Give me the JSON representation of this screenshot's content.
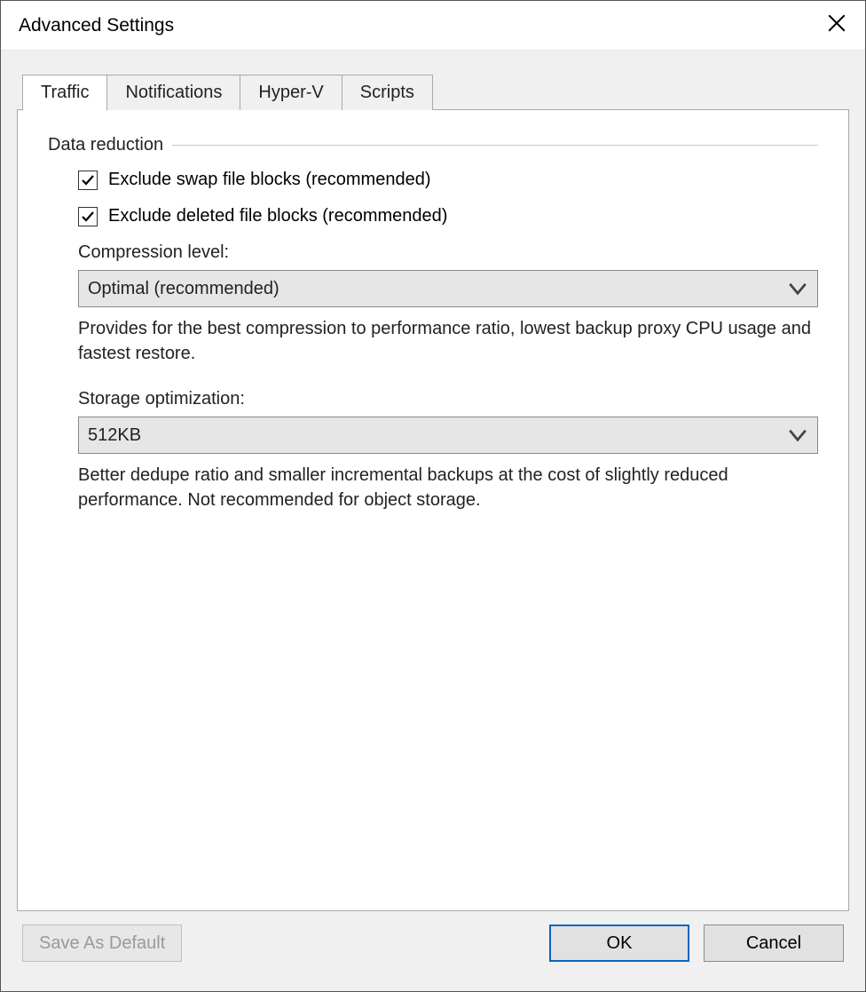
{
  "window": {
    "title": "Advanced Settings"
  },
  "tabs": [
    {
      "label": "Traffic",
      "active": true
    },
    {
      "label": "Notifications",
      "active": false
    },
    {
      "label": "Hyper-V",
      "active": false
    },
    {
      "label": "Scripts",
      "active": false
    }
  ],
  "group": {
    "title": "Data reduction"
  },
  "checks": {
    "swap": {
      "label": "Exclude swap file blocks (recommended)",
      "checked": true
    },
    "deleted": {
      "label": "Exclude deleted file blocks (recommended)",
      "checked": true
    }
  },
  "compression": {
    "label": "Compression level:",
    "value": "Optimal (recommended)",
    "desc": "Provides for the best compression to performance ratio, lowest backup proxy CPU usage and fastest restore."
  },
  "storage": {
    "label": "Storage optimization:",
    "value": "512KB",
    "desc": "Better dedupe ratio and smaller incremental backups at the cost of slightly reduced performance. Not recommended for object storage."
  },
  "buttons": {
    "saveDefault": "Save As Default",
    "ok": "OK",
    "cancel": "Cancel"
  }
}
